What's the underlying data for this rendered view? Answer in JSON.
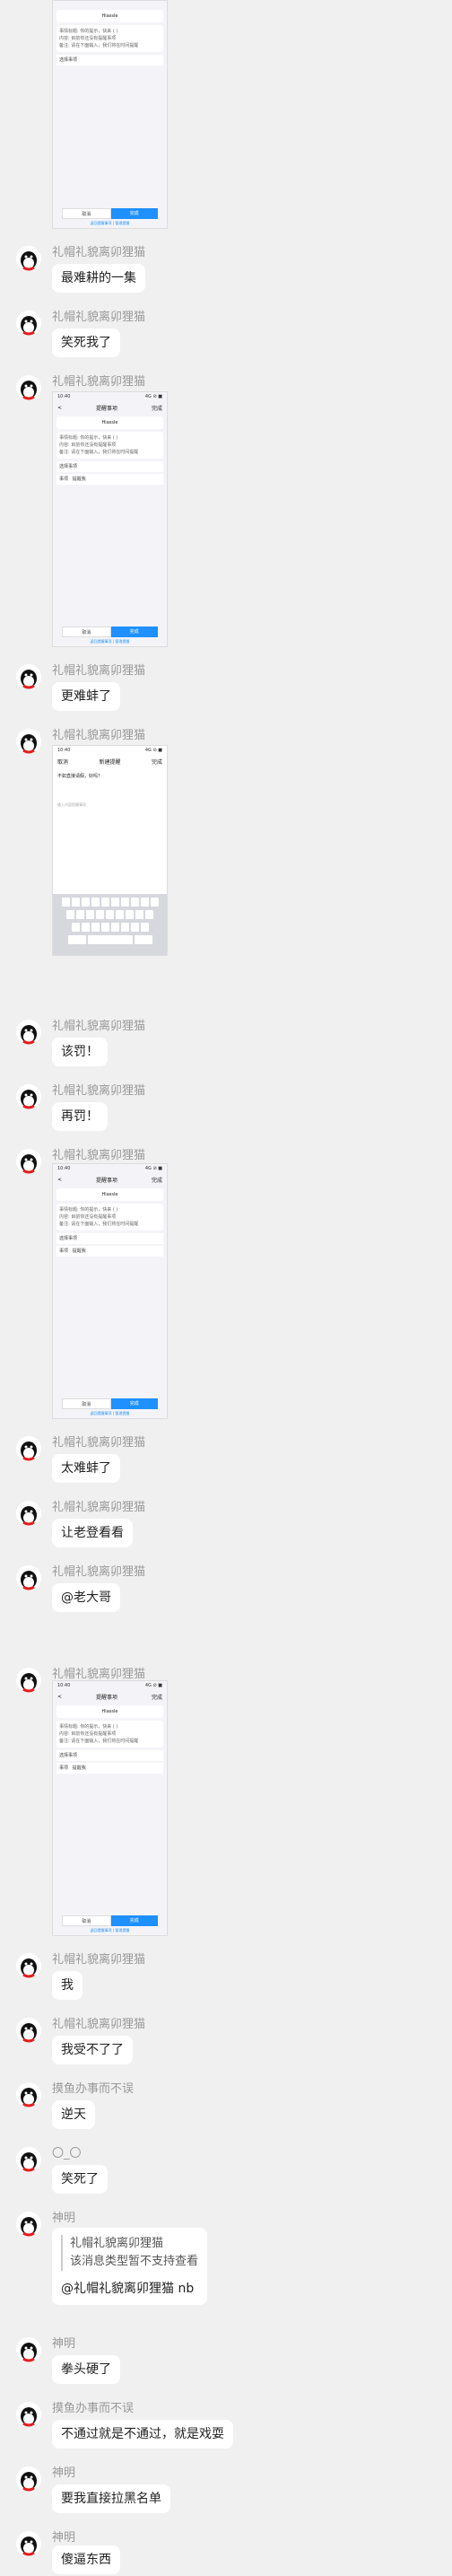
{
  "screenshots": {
    "status_time": "10:40",
    "status_right": "4G ⊘ ■",
    "nav_back": "<",
    "nav_title": "提醒事项",
    "nav_done": "完成",
    "card_title": "Hiassle",
    "card_line1": "事情标题: 你的提示，快来 ( )",
    "card_line2": "内容: 目前你还没有提醒事项",
    "card_line3": "备注: 请在下面输入，我们将在时间提醒",
    "row_label1": "选择事项",
    "row_label2": "事项",
    "row_value2": "提醒我",
    "btn_cancel": "取消",
    "btn_ok": "完成",
    "footer_link": "返回提醒事项 | 管理提醒",
    "editor_cancel": "取消",
    "editor_title": "新建提醒",
    "editor_done": "完成",
    "editor_text": "不如直接请假，好吗？",
    "editor_hint": "输入内容提醒事项"
  },
  "messages": [
    {
      "nick": "礼帽礼貌离卯狸猫",
      "text": "最难耕的一集"
    },
    {
      "nick": "礼帽礼貌离卯狸猫",
      "text": "笑死我了"
    },
    {
      "nick": "礼帽礼貌离卯狸猫",
      "text": ""
    },
    {
      "nick": "礼帽礼貌离卯狸猫",
      "text": "更难蚌了"
    },
    {
      "nick": "礼帽礼貌离卯狸猫",
      "text": ""
    },
    {
      "nick": "礼帽礼貌离卯狸猫",
      "text": "该罚！"
    },
    {
      "nick": "礼帽礼貌离卯狸猫",
      "text": "再罚！"
    },
    {
      "nick": "礼帽礼貌离卯狸猫",
      "text": ""
    },
    {
      "nick": "礼帽礼貌离卯狸猫",
      "text": "太难蚌了"
    },
    {
      "nick": "礼帽礼貌离卯狸猫",
      "text": "让老登看看"
    },
    {
      "nick": "礼帽礼貌离卯狸猫",
      "text": "@老大哥"
    },
    {
      "nick": "礼帽礼貌离卯狸猫",
      "text": ""
    },
    {
      "nick": "礼帽礼貌离卯狸猫",
      "text": "我"
    },
    {
      "nick": "礼帽礼貌离卯狸猫",
      "text": "我受不了了"
    },
    {
      "nick": "摸鱼办事而不误",
      "text": "逆天"
    },
    {
      "nick": "〇_〇",
      "text": "笑死了"
    },
    {
      "nick": "神明",
      "quote_nick": "礼帽礼貌离卯狸猫",
      "quote_text": "该消息类型暂不支持查看",
      "text": "@礼帽礼貌离卯狸猫 nb"
    },
    {
      "nick": "神明",
      "text": "拳头硬了"
    },
    {
      "nick": "摸鱼办事而不误",
      "text": "不通过就是不通过，就是戏耍"
    },
    {
      "nick": "神明",
      "text": "要我直接拉黑名单"
    },
    {
      "nick": "神明",
      "text": "傻逼东西"
    }
  ]
}
